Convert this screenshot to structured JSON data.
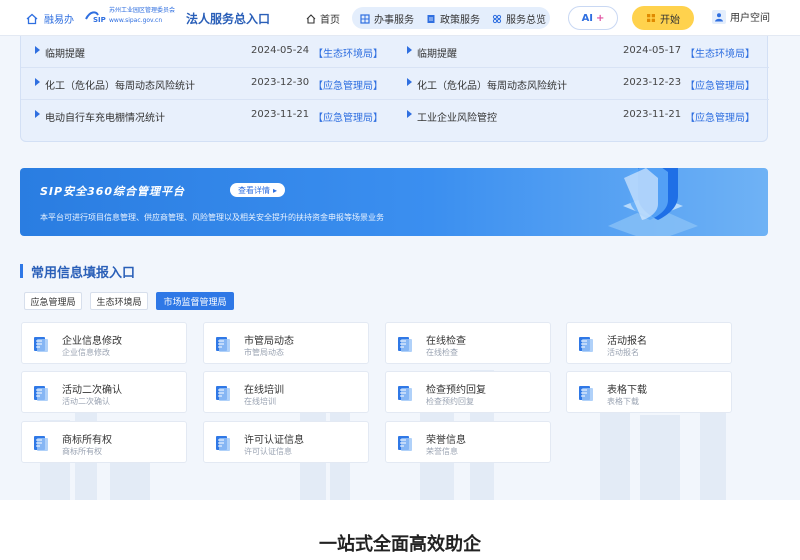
{
  "header": {
    "logo_text": "融易办",
    "org_name": "苏州工业园区管理委员会",
    "org_url": "www.sipac.gov.cn",
    "portal_title": "法人服务总入口",
    "nav": [
      "首页",
      "办事服务",
      "政策服务",
      "服务总览"
    ],
    "ai_label": "AI",
    "start_label": "开始",
    "user_label": "用户空间"
  },
  "news": {
    "rows": [
      {
        "left_title": "临期提醒",
        "left_date": "2024-05-24",
        "left_tag": "【生态环境局】",
        "right_title": "临期提醒",
        "right_date": "2024-05-17",
        "right_tag": "【生态环境局】"
      },
      {
        "left_title": "化工（危化品）每周动态风险统计",
        "left_date": "2023-12-30",
        "left_tag": "【应急管理局】",
        "right_title": "化工（危化品）每周动态风险统计",
        "right_date": "2023-12-23",
        "right_tag": "【应急管理局】"
      },
      {
        "left_title": "电动自行车充电棚情况统计",
        "left_date": "2023-11-21",
        "left_tag": "【应急管理局】",
        "right_title": "工业企业风险管控",
        "right_date": "2023-11-21",
        "right_tag": "【应急管理局】"
      }
    ]
  },
  "banner": {
    "title": "SIP安全360综合管理平台",
    "button": "查看详情",
    "description": "本平台可进行项目信息管理、供应商管理、风险管理以及相关安全提升的扶持资金申报等场景业务"
  },
  "section": {
    "title": "常用信息填报入口",
    "tabs": [
      "应急管理局",
      "生态环境局",
      "市场监督管理局"
    ],
    "active_tab": "市场监督管理局",
    "cards": [
      {
        "title": "企业信息修改",
        "sub": "企业信息修改"
      },
      {
        "title": "市管局动态",
        "sub": "市管局动态"
      },
      {
        "title": "在线检查",
        "sub": "在线检查"
      },
      {
        "title": "活动报名",
        "sub": "活动报名"
      },
      {
        "title": "活动二次确认",
        "sub": "活动二次确认"
      },
      {
        "title": "在线培训",
        "sub": "在线培训"
      },
      {
        "title": "检查预约回复",
        "sub": "检查预约回复"
      },
      {
        "title": "表格下载",
        "sub": "表格下载"
      },
      {
        "title": "商标所有权",
        "sub": "商标所有权"
      },
      {
        "title": "许可认证信息",
        "sub": "许可认证信息"
      },
      {
        "title": "荣誉信息",
        "sub": "荣誉信息"
      }
    ]
  },
  "bottom": {
    "title": "一站式全面高效助企"
  },
  "colors": {
    "accent": "#2f78e6",
    "tag": "#2f6fe0",
    "banner": "#2a7de1",
    "start_btn": "#ffd24d"
  }
}
